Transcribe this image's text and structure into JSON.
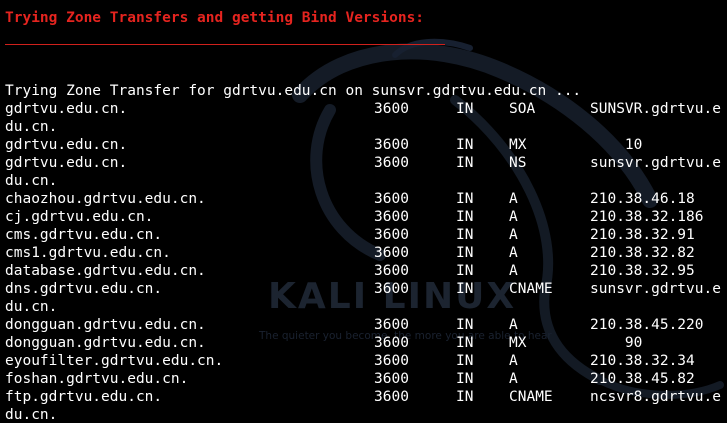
{
  "heading": "Trying Zone Transfers and getting Bind Versions:",
  "watermark": {
    "logo_text": "KALI LINUX",
    "tagline": "The quieter you become, the more you are able to hear"
  },
  "colors": {
    "background": "#000000",
    "text": "#ffffff",
    "heading": "#e5241f",
    "watermark": "#1c2430"
  },
  "transfer_line": "Trying Zone Transfer for gdrtvu.edu.cn on sunsvr.gdrtvu.edu.cn ...",
  "records": [
    {
      "host": "gdrtvu.edu.cn.",
      "ttl": "3600",
      "class": "IN",
      "type": "SOA",
      "value": "SUNSVR.gdrtvu.e"
    },
    {
      "wrap": "du.cn."
    },
    {
      "host": "gdrtvu.edu.cn.",
      "ttl": "3600",
      "class": "IN",
      "type": "MX",
      "value": "    10"
    },
    {
      "host": "gdrtvu.edu.cn.",
      "ttl": "3600",
      "class": "IN",
      "type": "NS",
      "value": "sunsvr.gdrtvu.e"
    },
    {
      "wrap": "du.cn."
    },
    {
      "host": "chaozhou.gdrtvu.edu.cn.",
      "ttl": "3600",
      "class": "IN",
      "type": "A",
      "value": "210.38.46.18"
    },
    {
      "host": "cj.gdrtvu.edu.cn.",
      "ttl": "3600",
      "class": "IN",
      "type": "A",
      "value": "210.38.32.186"
    },
    {
      "host": "cms.gdrtvu.edu.cn.",
      "ttl": "3600",
      "class": "IN",
      "type": "A",
      "value": "210.38.32.91"
    },
    {
      "host": "cms1.gdrtvu.edu.cn.",
      "ttl": "3600",
      "class": "IN",
      "type": "A",
      "value": "210.38.32.82"
    },
    {
      "host": "database.gdrtvu.edu.cn.",
      "ttl": "3600",
      "class": "IN",
      "type": "A",
      "value": "210.38.32.95"
    },
    {
      "host": "dns.gdrtvu.edu.cn.",
      "ttl": "3600",
      "class": "IN",
      "type": "CNAME",
      "value": "sunsvr.gdrtvu.e"
    },
    {
      "wrap": "du.cn."
    },
    {
      "host": "dongguan.gdrtvu.edu.cn.",
      "ttl": "3600",
      "class": "IN",
      "type": "A",
      "value": "210.38.45.220"
    },
    {
      "host": "dongguan.gdrtvu.edu.cn.",
      "ttl": "3600",
      "class": "IN",
      "type": "MX",
      "value": "    90"
    },
    {
      "host": "eyoufilter.gdrtvu.edu.cn.",
      "ttl": "3600",
      "class": "IN",
      "type": "A",
      "value": "210.38.32.34"
    },
    {
      "host": "foshan.gdrtvu.edu.cn.",
      "ttl": "3600",
      "class": "IN",
      "type": "A",
      "value": "210.38.45.82"
    },
    {
      "host": "ftp.gdrtvu.edu.cn.",
      "ttl": "3600",
      "class": "IN",
      "type": "CNAME",
      "value": "ncsvr8.gdrtvu.e"
    },
    {
      "wrap": "du.cn."
    }
  ]
}
